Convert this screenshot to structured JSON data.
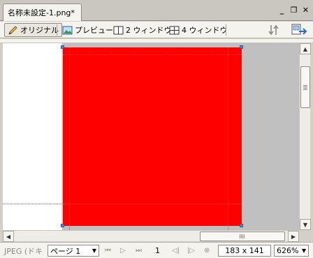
{
  "tab": {
    "title": "名称未設定-1.png*"
  },
  "window_controls": {
    "minimize": "_",
    "restore": "❐",
    "close": "✕"
  },
  "toolbar": {
    "original": "オリジナル",
    "preview": "プレビュー",
    "two_window": "2 ウィンドウ",
    "four_window": "4 ウィンドウ"
  },
  "status": {
    "format": "JPEG (ドキ",
    "page": "ページ 1",
    "frame": "1",
    "dimensions": "183 x 141",
    "zoom": "626%"
  },
  "colors": {
    "image_fill": "#ff0000",
    "accent": "#3a8ee6"
  },
  "icons": {
    "original": "pencil-icon",
    "preview": "image-preview-icon",
    "two_window": "two-panel-icon",
    "four_window": "four-panel-icon",
    "export": "export-icon",
    "quick_export": "quick-export-icon"
  }
}
